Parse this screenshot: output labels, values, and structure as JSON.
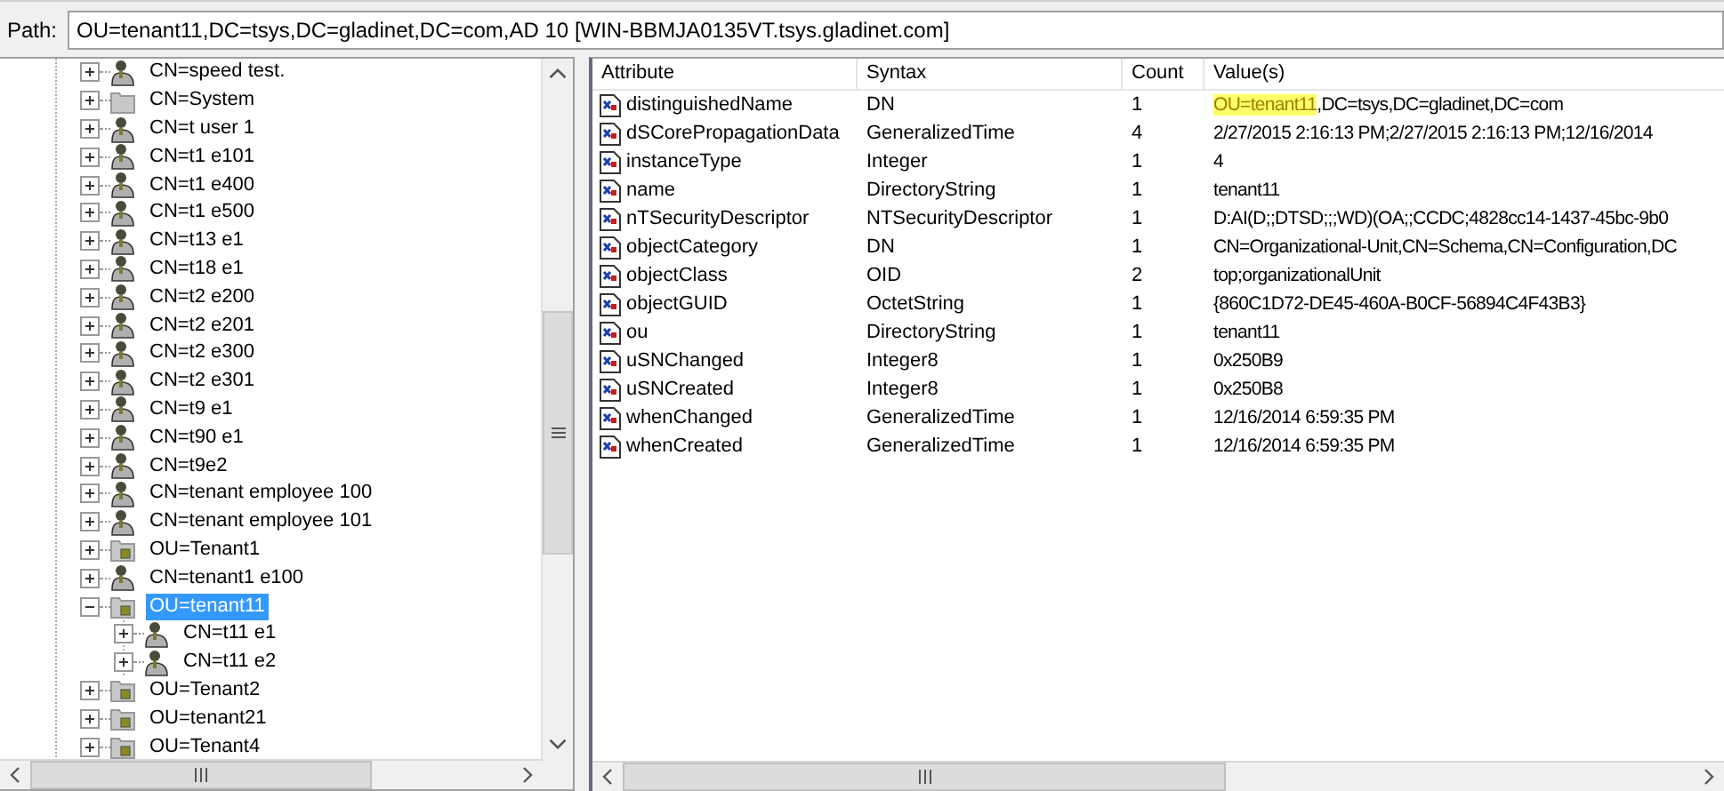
{
  "path_bar": {
    "label": "Path:",
    "value": "OU=tenant11,DC=tsys,DC=gladinet,DC=com,AD 10 [WIN-BBMJA0135VT.tsys.gladinet.com]"
  },
  "tree": {
    "items": [
      {
        "label": "CN=speed test.",
        "kind": "user",
        "expanded": false,
        "selected": false
      },
      {
        "label": "CN=System",
        "kind": "container",
        "expanded": false,
        "selected": false
      },
      {
        "label": "CN=t user 1",
        "kind": "user",
        "expanded": false,
        "selected": false
      },
      {
        "label": "CN=t1 e101",
        "kind": "user",
        "expanded": false,
        "selected": false
      },
      {
        "label": "CN=t1 e400",
        "kind": "user",
        "expanded": false,
        "selected": false
      },
      {
        "label": "CN=t1 e500",
        "kind": "user",
        "expanded": false,
        "selected": false
      },
      {
        "label": "CN=t13 e1",
        "kind": "user",
        "expanded": false,
        "selected": false
      },
      {
        "label": "CN=t18 e1",
        "kind": "user",
        "expanded": false,
        "selected": false
      },
      {
        "label": "CN=t2 e200",
        "kind": "user",
        "expanded": false,
        "selected": false
      },
      {
        "label": "CN=t2 e201",
        "kind": "user",
        "expanded": false,
        "selected": false
      },
      {
        "label": "CN=t2 e300",
        "kind": "user",
        "expanded": false,
        "selected": false
      },
      {
        "label": "CN=t2 e301",
        "kind": "user",
        "expanded": false,
        "selected": false
      },
      {
        "label": "CN=t9 e1",
        "kind": "user",
        "expanded": false,
        "selected": false
      },
      {
        "label": "CN=t90 e1",
        "kind": "user",
        "expanded": false,
        "selected": false
      },
      {
        "label": "CN=t9e2",
        "kind": "user",
        "expanded": false,
        "selected": false
      },
      {
        "label": "CN=tenant employee 100",
        "kind": "user",
        "expanded": false,
        "selected": false
      },
      {
        "label": "CN=tenant employee 101",
        "kind": "user",
        "expanded": false,
        "selected": false
      },
      {
        "label": "OU=Tenant1",
        "kind": "ou",
        "expanded": false,
        "selected": false
      },
      {
        "label": "CN=tenant1 e100",
        "kind": "user",
        "expanded": false,
        "selected": false
      },
      {
        "label": "OU=tenant11",
        "kind": "ou",
        "expanded": true,
        "selected": true,
        "children": [
          {
            "label": "CN=t11 e1",
            "kind": "user",
            "expanded": false,
            "selected": false
          },
          {
            "label": "CN=t11 e2",
            "kind": "user",
            "expanded": false,
            "selected": false
          }
        ]
      },
      {
        "label": "OU=Tenant2",
        "kind": "ou",
        "expanded": false,
        "selected": false
      },
      {
        "label": "OU=tenant21",
        "kind": "ou",
        "expanded": false,
        "selected": false
      },
      {
        "label": "OU=Tenant4",
        "kind": "ou",
        "expanded": false,
        "selected": false
      }
    ]
  },
  "table": {
    "columns": [
      "Attribute",
      "Syntax",
      "Count",
      "Value(s)"
    ],
    "rows": [
      {
        "attribute": "distinguishedName",
        "syntax": "DN",
        "count": "1",
        "value": [
          {
            "text": "OU=tenant11",
            "highlighted": true
          },
          {
            "text": ",DC=tsys,DC=gladinet,DC=com",
            "highlighted": false
          }
        ]
      },
      {
        "attribute": "dSCorePropagationData",
        "syntax": "GeneralizedTime",
        "count": "4",
        "value": [
          {
            "text": "2/27/2015 2:16:13 PM;2/27/2015 2:16:13 PM;12/16/2014",
            "highlighted": false
          }
        ]
      },
      {
        "attribute": "instanceType",
        "syntax": "Integer",
        "count": "1",
        "value": [
          {
            "text": "4",
            "highlighted": false
          }
        ]
      },
      {
        "attribute": "name",
        "syntax": "DirectoryString",
        "count": "1",
        "value": [
          {
            "text": "tenant11",
            "highlighted": false
          }
        ]
      },
      {
        "attribute": "nTSecurityDescriptor",
        "syntax": "NTSecurityDescriptor",
        "count": "1",
        "value": [
          {
            "text": "D:AI(D;;DTSD;;;WD)(OA;;CCDC;4828cc14-1437-45bc-9b0",
            "highlighted": false
          }
        ]
      },
      {
        "attribute": "objectCategory",
        "syntax": "DN",
        "count": "1",
        "value": [
          {
            "text": "CN=Organizational-Unit,CN=Schema,CN=Configuration,DC",
            "highlighted": false
          }
        ]
      },
      {
        "attribute": "objectClass",
        "syntax": "OID",
        "count": "2",
        "value": [
          {
            "text": "top;organizationalUnit",
            "highlighted": false
          }
        ]
      },
      {
        "attribute": "objectGUID",
        "syntax": "OctetString",
        "count": "1",
        "value": [
          {
            "text": "{860C1D72-DE45-460A-B0CF-56894C4F43B3}",
            "highlighted": false
          }
        ]
      },
      {
        "attribute": "ou",
        "syntax": "DirectoryString",
        "count": "1",
        "value": [
          {
            "text": "tenant11",
            "highlighted": false
          }
        ]
      },
      {
        "attribute": "uSNChanged",
        "syntax": "Integer8",
        "count": "1",
        "value": [
          {
            "text": "0x250B9",
            "highlighted": false
          }
        ]
      },
      {
        "attribute": "uSNCreated",
        "syntax": "Integer8",
        "count": "1",
        "value": [
          {
            "text": "0x250B8",
            "highlighted": false
          }
        ]
      },
      {
        "attribute": "whenChanged",
        "syntax": "GeneralizedTime",
        "count": "1",
        "value": [
          {
            "text": "12/16/2014 6:59:35 PM",
            "highlighted": false
          }
        ]
      },
      {
        "attribute": "whenCreated",
        "syntax": "GeneralizedTime",
        "count": "1",
        "value": [
          {
            "text": "12/16/2014 6:59:35 PM",
            "highlighted": false
          }
        ]
      }
    ]
  }
}
